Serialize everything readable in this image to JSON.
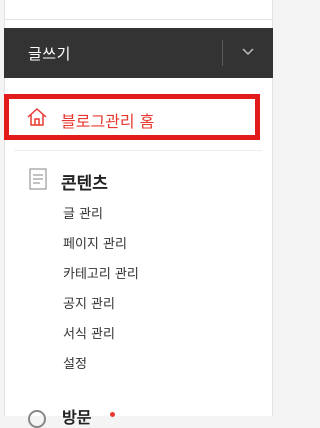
{
  "write": {
    "label": "글쓰기"
  },
  "home": {
    "label": "블로그관리 홈"
  },
  "content": {
    "title": "콘텐츠",
    "items": [
      "글 관리",
      "페이지 관리",
      "카테고리 관리",
      "공지 관리",
      "서식 관리",
      "설정"
    ]
  },
  "next_section": {
    "label": "방문"
  },
  "colors": {
    "accent": "#e8382f",
    "highlight_box": "#e21b1b",
    "write_bar": "#333333"
  }
}
